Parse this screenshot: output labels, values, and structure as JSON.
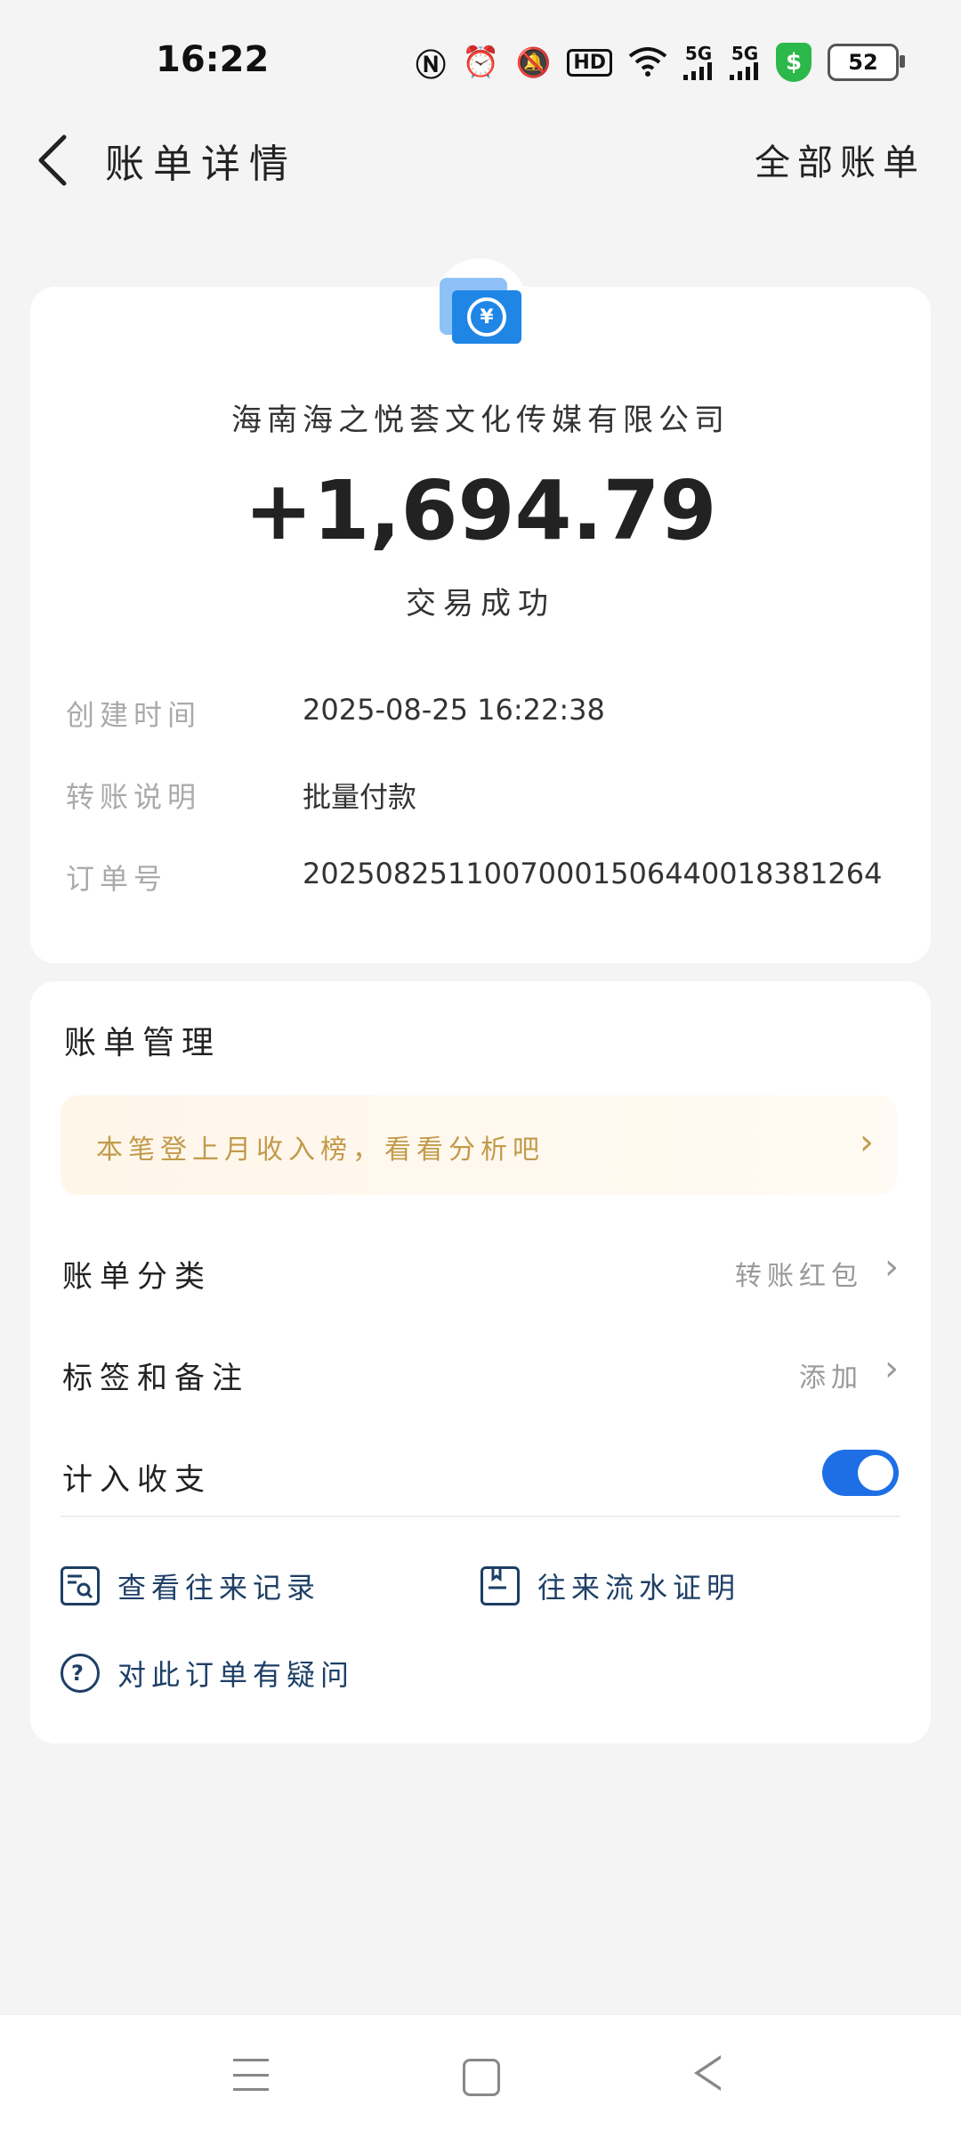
{
  "status_bar": {
    "time": "16:22",
    "icons": [
      "nfc-icon",
      "alarm-icon",
      "mute-icon",
      "hd-icon",
      "wifi-icon",
      "5g-signal-icon",
      "5g-signal-icon",
      "security-shield-icon",
      "battery-icon"
    ],
    "hd_label": "HD",
    "signal1": "5G",
    "signal2": "5G",
    "battery": "52"
  },
  "header": {
    "title": "账单详情",
    "all_bills": "全部账单"
  },
  "transaction": {
    "company": "海南海之悦荟文化传媒有限公司",
    "amount": "+1,694.79",
    "status": "交易成功",
    "details": [
      {
        "label": "创建时间",
        "value": "2025-08-25 16:22:38"
      },
      {
        "label": "转账说明",
        "value": "批量付款"
      },
      {
        "label": "订单号",
        "value": "20250825110070001506440018381264"
      }
    ]
  },
  "management": {
    "title": "账单管理",
    "promo": "本笔登上月收入榜，看看分析吧",
    "rows": [
      {
        "label": "账单分类",
        "value": "转账红包"
      },
      {
        "label": "标签和备注",
        "value": "添加"
      },
      {
        "label": "计入收支",
        "value": ""
      }
    ],
    "links": {
      "records": "查看往来记录",
      "proof": "往来流水证明",
      "question": "对此订单有疑问"
    },
    "toggle_on": true
  },
  "colors": {
    "accent": "#1e6fe6",
    "promo_text": "#c29a4a",
    "link_text": "#1d3f66"
  }
}
